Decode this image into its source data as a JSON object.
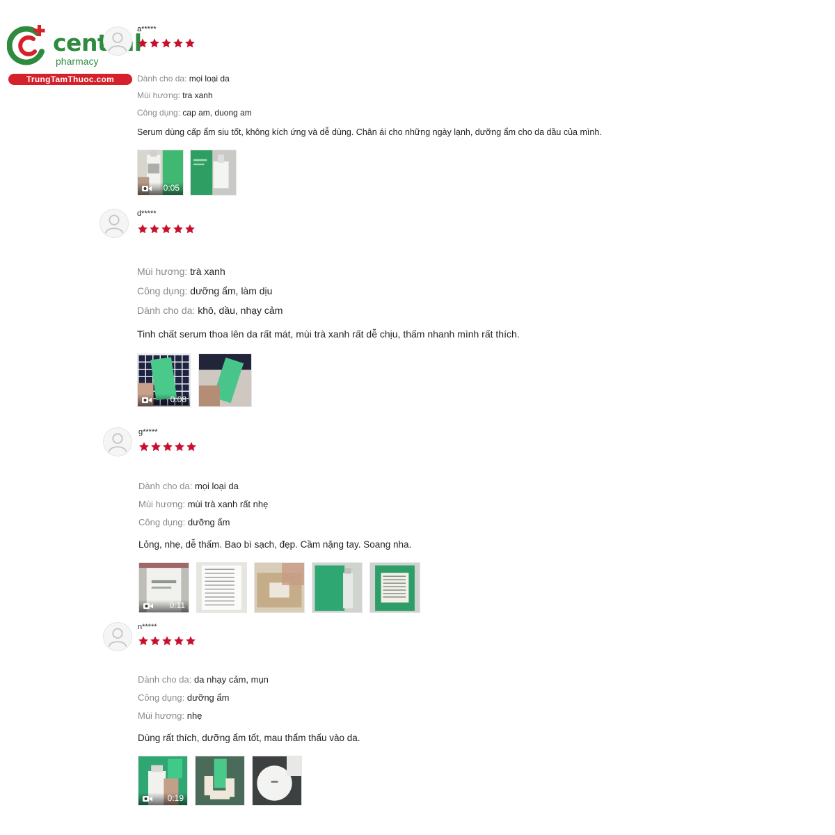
{
  "brand": {
    "name": "central",
    "sub": "pharmacy",
    "site": "TrungTamThuoc.com",
    "colors": {
      "green": "#2e8b3e",
      "red": "#d6202a"
    }
  },
  "reviews": [
    {
      "username": "a*****",
      "rating": 5,
      "attributes": [
        {
          "key": "Dành cho da:",
          "value": "mọi loại da"
        },
        {
          "key": "Mùi hương:",
          "value": "tra xanh"
        },
        {
          "key": "Công dụng:",
          "value": "cap am, duong am"
        }
      ],
      "comment": "Serum dùng cấp ẩm siu tốt, không kích ứng và dễ dùng. Chân ái cho những ngày lạnh, dưỡng ẩm cho da dầu của mình.",
      "media": [
        {
          "type": "video",
          "duration": "0:05",
          "thumb": "bottle-in-hand"
        },
        {
          "type": "image",
          "thumb": "bottle-with-box"
        }
      ]
    },
    {
      "username": "d*****",
      "rating": 5,
      "attributes": [
        {
          "key": "Mùi hương:",
          "value": "trà xanh"
        },
        {
          "key": "Công dụng:",
          "value": "dưỡng ẩm, làm dịu"
        },
        {
          "key": "Dành cho da:",
          "value": "khô, dầu, nhạy cảm"
        }
      ],
      "comment": "Tinh chất serum thoa lên da rất mát, mùi trà xanh rất dễ chịu, thấm nhanh mình rất thích.",
      "media": [
        {
          "type": "video",
          "duration": "0:08",
          "thumb": "green-box-on-plaid"
        },
        {
          "type": "image",
          "thumb": "green-box-held"
        }
      ]
    },
    {
      "username": "g*****",
      "rating": 5,
      "attributes": [
        {
          "key": "Dành cho da:",
          "value": "mọi loại da"
        },
        {
          "key": "Mùi hương:",
          "value": "mùi trà xanh rất nhẹ"
        },
        {
          "key": "Công dụng:",
          "value": "dưỡng ẩm"
        }
      ],
      "comment": "Lỏng, nhẹ, dễ thấm. Bao bì sạch, đẹp. Cầm nặng tay. Soang nha.",
      "media": [
        {
          "type": "video",
          "duration": "0:11",
          "thumb": "bottle-closeup"
        },
        {
          "type": "image",
          "thumb": "receipt"
        },
        {
          "type": "image",
          "thumb": "parcel"
        },
        {
          "type": "image",
          "thumb": "green-box-with-bottle"
        },
        {
          "type": "image",
          "thumb": "green-box-back"
        }
      ]
    },
    {
      "username": "n*****",
      "rating": 5,
      "attributes": [
        {
          "key": "Dành cho da:",
          "value": "da nhạy cảm, mụn"
        },
        {
          "key": "Công dụng:",
          "value": "dưỡng ẩm"
        },
        {
          "key": "Mùi hương:",
          "value": "nhẹ"
        }
      ],
      "comment": "Dùng rất thích, dưỡng ẩm tốt, mau thẩm thấu vào da.",
      "media": [
        {
          "type": "video",
          "duration": "0:19",
          "thumb": "bottle-in-hand-green"
        },
        {
          "type": "image",
          "thumb": "product-set"
        },
        {
          "type": "image",
          "thumb": "cream-jar"
        }
      ]
    }
  ]
}
